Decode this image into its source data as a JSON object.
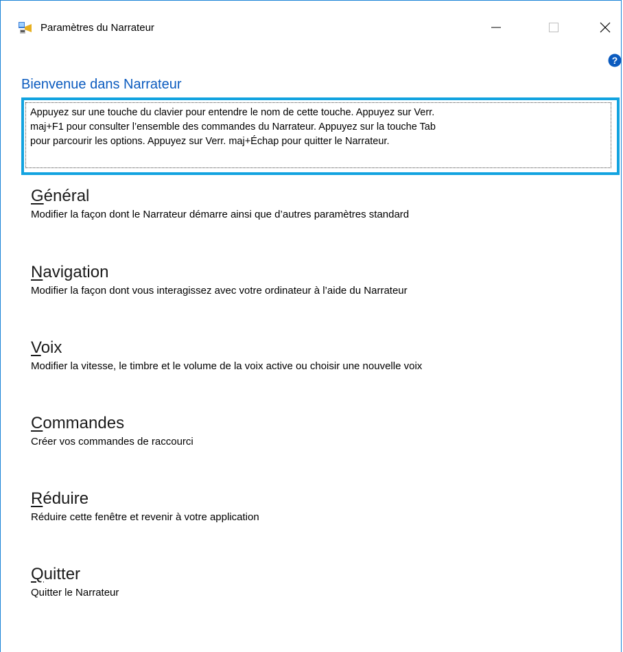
{
  "window": {
    "title": "Paramètres du Narrateur",
    "accent_color": "#1883d7"
  },
  "caption_buttons": {
    "minimize_icon": "minimize-icon",
    "maximize_icon": "maximize-icon",
    "close_icon": "close-icon"
  },
  "help": {
    "icon": "help-icon",
    "color": "#0b5bbf"
  },
  "welcome": {
    "heading": "Bienvenue dans Narrateur",
    "heading_color": "#0b5bbf",
    "intro_line1": "Appuyez sur une touche du clavier pour entendre le nom de cette touche. Appuyez sur Verr.",
    "intro_line2": "maj+F1 pour consulter l’ensemble des commandes du Narrateur. Appuyez sur la touche Tab",
    "intro_line3": "pour parcourir les options. Appuyez sur Verr. maj+Échap pour quitter le Narrateur.",
    "focus_color": "#12a3e0"
  },
  "menu": [
    {
      "accel": "G",
      "rest": "énéral",
      "desc": "Modifier la façon dont le Narrateur démarre ainsi que d’autres paramètres standard"
    },
    {
      "accel": "N",
      "rest": "avigation",
      "desc": "Modifier la façon dont vous interagissez avec votre ordinateur à l’aide du Narrateur"
    },
    {
      "accel": "V",
      "rest": "oix",
      "desc": "Modifier la vitesse, le timbre et le volume de la voix active ou choisir une nouvelle voix"
    },
    {
      "accel": "C",
      "rest": "ommandes",
      "desc": "Créer vos commandes de raccourci"
    },
    {
      "accel": "R",
      "rest": "éduire",
      "desc": "Réduire cette fenêtre et revenir à votre application"
    },
    {
      "accel": "Q",
      "rest": "uitter",
      "desc": "Quitter le Narrateur"
    }
  ]
}
